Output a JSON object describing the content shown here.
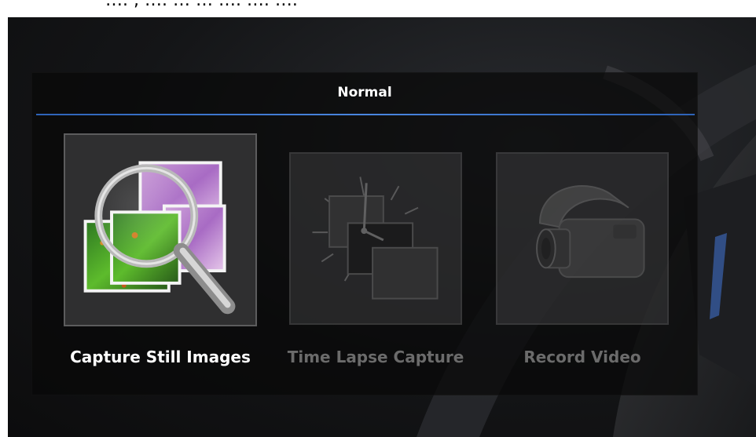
{
  "caption": {
    "visible_text": "…. , …. … … …. …. …."
  },
  "panel": {
    "mode_title": "Normal"
  },
  "modes": [
    {
      "label": "Capture Still Images",
      "icon": "magnifier-over-micrographs-icon",
      "state": "active"
    },
    {
      "label": "Time Lapse Capture",
      "icon": "clock-over-frames-icon",
      "state": "disabled"
    },
    {
      "label": "Record Video",
      "icon": "video-camera-icon",
      "state": "disabled"
    }
  ],
  "colors": {
    "accent_line": "#4a86e0",
    "active_text": "#ffffff",
    "disabled_text": "#6b6b6b"
  }
}
